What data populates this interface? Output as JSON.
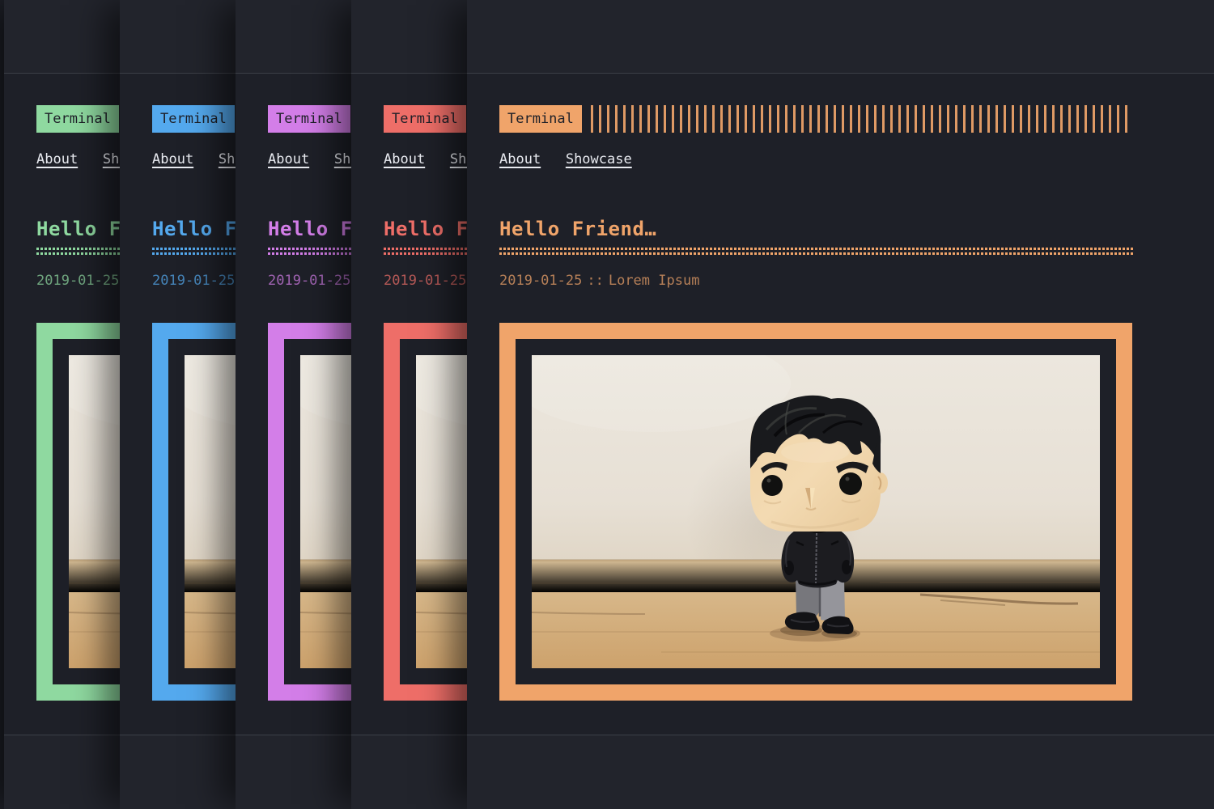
{
  "site": {
    "logo": "Terminal",
    "nav": [
      {
        "label": "About"
      },
      {
        "label": "Showcase"
      }
    ],
    "post": {
      "title": "Hello Friend…",
      "date": "2019-01-25",
      "separator": "::",
      "author": "Lorem Ipsum"
    },
    "photo": {
      "name": "mr-robot-funko-figure-on-wooden-floor"
    }
  },
  "panels": [
    {
      "name": "green",
      "accent": "#8fd9a0"
    },
    {
      "name": "blue",
      "accent": "#54a9ee"
    },
    {
      "name": "purple",
      "accent": "#d37ee8"
    },
    {
      "name": "red",
      "accent": "#ee6e68"
    },
    {
      "name": "orange",
      "accent": "#f0a46a"
    }
  ],
  "theme": {
    "bg": "#1e2028",
    "band": "#22242c",
    "line": "#3c3f47",
    "text": "#e9ebf1",
    "badgetext": "#1e2028"
  }
}
